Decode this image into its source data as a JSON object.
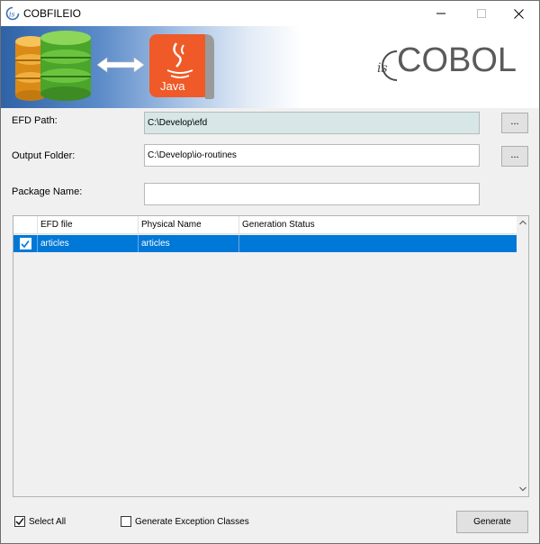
{
  "window": {
    "title": "COBFILEIO",
    "icon": "iscobol-app-icon",
    "controls": [
      "minimize-icon",
      "maximize-icon",
      "close-icon"
    ]
  },
  "banner": {
    "logo_prefix": "is",
    "logo_word": "COBOL",
    "java_label": "Java"
  },
  "form": {
    "efd_path": {
      "label": "EFD Path:",
      "value": "C:\\Develop\\efd",
      "browse_label": "..."
    },
    "output_folder": {
      "label": "Output Folder:",
      "value": "C:\\Develop\\io-routines",
      "browse_label": "..."
    },
    "package_name": {
      "label": "Package Name:",
      "value": ""
    }
  },
  "table": {
    "columns": [
      "EFD file",
      "Physical Name",
      "Generation Status"
    ],
    "rows": [
      {
        "checked": true,
        "efd_file": "articles",
        "physical_name": "articles",
        "generation_status": ""
      }
    ]
  },
  "footer": {
    "select_all": {
      "label": "Select All",
      "checked": true
    },
    "generate_exceptions": {
      "label": "Generate Exception Classes",
      "checked": false
    },
    "generate_button": "Generate"
  },
  "colors": {
    "selection": "#0078d7",
    "readonly_field": "#d7e7e7",
    "java_orange": "#ef5a28",
    "db_green": "#5cb531",
    "db_orange": "#e49a21"
  }
}
